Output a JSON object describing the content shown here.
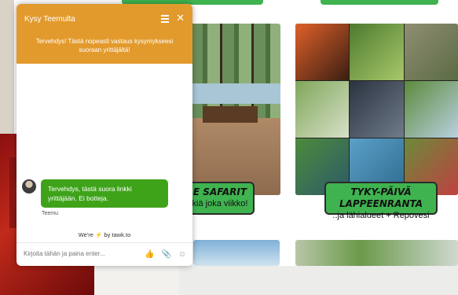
{
  "chat": {
    "title": "Kysy Teemulta",
    "intro": "Tervehdys! Tästä nopeasti vastaus kysymykseesi suoraan yrittäjältä!",
    "message": "Tervehdys, tästä suora linkki yrittäjään. Ei botteja.",
    "sender": "Teemu",
    "powered_prefix": "We're",
    "powered_bolt": "⚡",
    "powered_suffix": "by",
    "powered_brand": "tawk.to",
    "input_placeholder": "Kirjoita tähän ja paina enter...",
    "icons": {
      "like": "👍",
      "attach": "📎",
      "emoji": "☺"
    }
  },
  "cards": [
    {
      "title_visible": "E SAFARIT",
      "subtitle_visible": "kiä joka viikko!"
    },
    {
      "title": "TYKY-PÄIVÄ LAPPEENRANTA",
      "subtitle": "..ja lähialueet + Repovesi"
    }
  ],
  "colors": {
    "chat_header": "#e39a2c",
    "bubble": "#3fa31a",
    "label_green": "#3fb34f"
  }
}
